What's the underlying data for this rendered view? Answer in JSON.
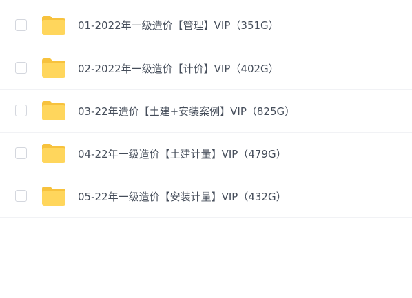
{
  "files": [
    {
      "name": "01-2022年一级造价【管理】VIP（351G）",
      "icon": "folder-icon",
      "checked": false
    },
    {
      "name": "02-2022年一级造价【计价】VIP（402G）",
      "icon": "folder-icon",
      "checked": false
    },
    {
      "name": "03-22年造价【土建+安装案例】VIP（825G）",
      "icon": "folder-icon",
      "checked": false
    },
    {
      "name": "04-22年一级造价【土建计量】VIP（479G）",
      "icon": "folder-icon",
      "checked": false
    },
    {
      "name": "05-22年一级造价【安装计量】VIP（432G）",
      "icon": "folder-icon",
      "checked": false
    }
  ],
  "colors": {
    "folder_front": "#ffd65c",
    "folder_back": "#f7c23d",
    "text": "#454d5a",
    "divider": "#f1f2f5",
    "checkbox_border": "#d4d7de"
  }
}
